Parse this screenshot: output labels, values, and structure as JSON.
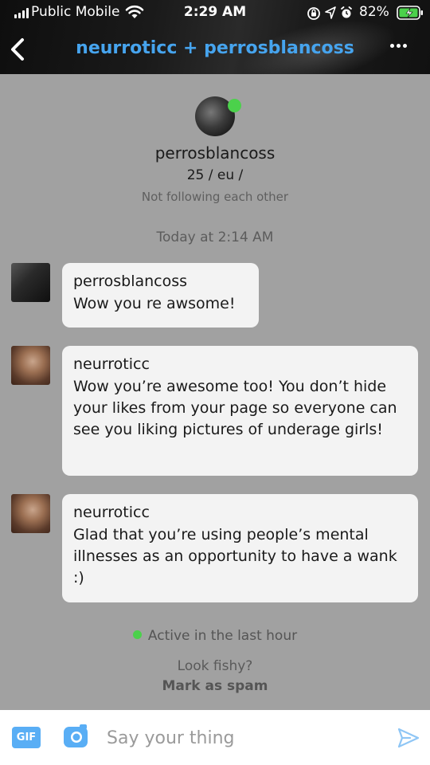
{
  "status_bar": {
    "carrier": "Public Mobile",
    "time": "2:29 AM",
    "battery_percent": "82%"
  },
  "header": {
    "title": "neurroticc + perrosblancoss"
  },
  "profile": {
    "username": "perrosblancoss",
    "meta": "25 / eu /",
    "follow_status": "Not following each other",
    "online": true
  },
  "conversation": {
    "timestamp": "Today at 2:14 AM",
    "messages": [
      {
        "sender": "perrosblancoss",
        "text": "Wow you re awsome!",
        "avatar": "dark"
      },
      {
        "sender": "neurroticc",
        "text": "Wow you’re awesome too! You don’t hide your likes from your page so everyone can see you liking pictures of underage girls!",
        "avatar": "warm"
      },
      {
        "sender": "neurroticc",
        "text": "Glad that you’re using people’s mental illnesses as an opportunity to have a wank :)",
        "avatar": "warm"
      }
    ]
  },
  "footer": {
    "active_status": "Active in the last hour",
    "fishy_prompt": "Look fishy?",
    "spam_link": "Mark as spam"
  },
  "composer": {
    "gif_label": "GIF",
    "placeholder": "Say your thing"
  },
  "colors": {
    "accent_blue": "#46a4ee",
    "online_green": "#4bd14b",
    "background": "#a1a1a1",
    "bubble": "#f3f3f3"
  },
  "icons": [
    "signal-icon",
    "wifi-icon",
    "orientation-lock-icon",
    "location-icon",
    "alarm-icon",
    "battery-icon",
    "back-chevron-icon",
    "more-icon",
    "camera-icon",
    "send-icon"
  ]
}
